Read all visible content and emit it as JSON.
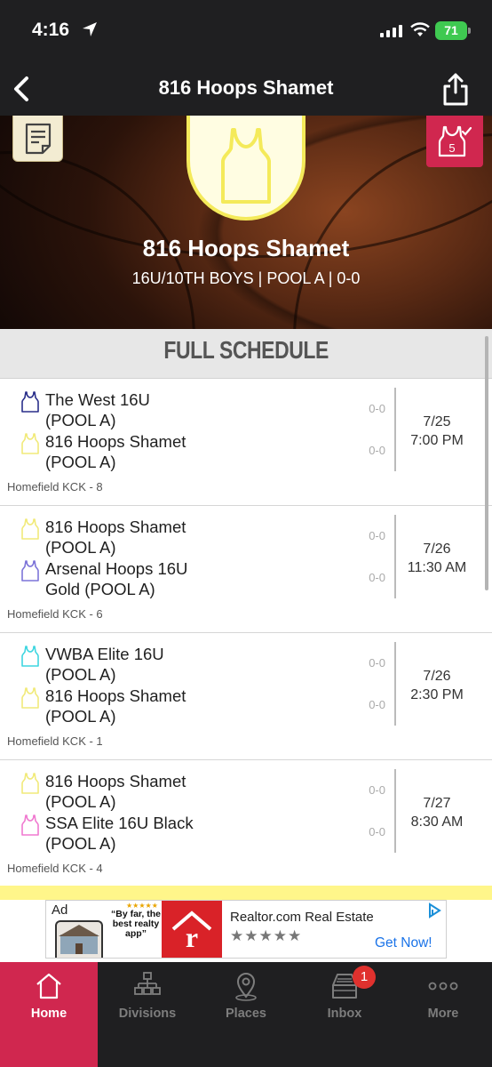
{
  "status_bar": {
    "time": "4:16",
    "battery": "71"
  },
  "header": {
    "title": "816 Hoops Shamet"
  },
  "hero": {
    "team_name": "816 Hoops Shamet",
    "subtitle": "16U/10TH BOYS | POOL A | 0-0",
    "badge_count": "5"
  },
  "schedule": {
    "title": "FULL SCHEDULE",
    "games": [
      {
        "team1": "The West 16U\n(POOL A)",
        "team1_score": "0-0",
        "team1_color": "#2a2f8a",
        "team2": "816 Hoops Shamet\n(POOL A)",
        "team2_score": "0-0",
        "team2_color": "#f1ea7a",
        "date": "7/25",
        "time": "7:00 PM",
        "venue": "Homefield KCK - 8"
      },
      {
        "team1": "816 Hoops Shamet\n(POOL A)",
        "team1_score": "0-0",
        "team1_color": "#f1ea7a",
        "team2": "Arsenal Hoops 16U\nGold (POOL A)",
        "team2_score": "0-0",
        "team2_color": "#7d74d8",
        "date": "7/26",
        "time": "11:30 AM",
        "venue": "Homefield KCK - 6"
      },
      {
        "team1": "VWBA Elite 16U\n(POOL A)",
        "team1_score": "0-0",
        "team1_color": "#3fd6e0",
        "team2": "816 Hoops Shamet\n(POOL A)",
        "team2_score": "0-0",
        "team2_color": "#f1ea7a",
        "date": "7/26",
        "time": "2:30 PM",
        "venue": "Homefield KCK - 1"
      },
      {
        "team1": "816 Hoops Shamet\n(POOL A)",
        "team1_score": "0-0",
        "team1_color": "#f1ea7a",
        "team2": "SSA Elite 16U Black\n(POOL A)",
        "team2_score": "0-0",
        "team2_color": "#f07ad0",
        "date": "7/27",
        "time": "8:30 AM",
        "venue": "Homefield KCK - 4"
      }
    ]
  },
  "ad": {
    "label": "Ad",
    "quote": "“By far, the best realty app”",
    "title": "Realtor.com Real Estate",
    "stars": "★★★★★",
    "cta": "Get Now!"
  },
  "tabs": [
    {
      "label": "Home",
      "icon": "home-icon"
    },
    {
      "label": "Divisions",
      "icon": "bracket-icon"
    },
    {
      "label": "Places",
      "icon": "map-pin-icon"
    },
    {
      "label": "Inbox",
      "icon": "inbox-icon",
      "badge": "1"
    },
    {
      "label": "More",
      "icon": "more-icon"
    }
  ]
}
